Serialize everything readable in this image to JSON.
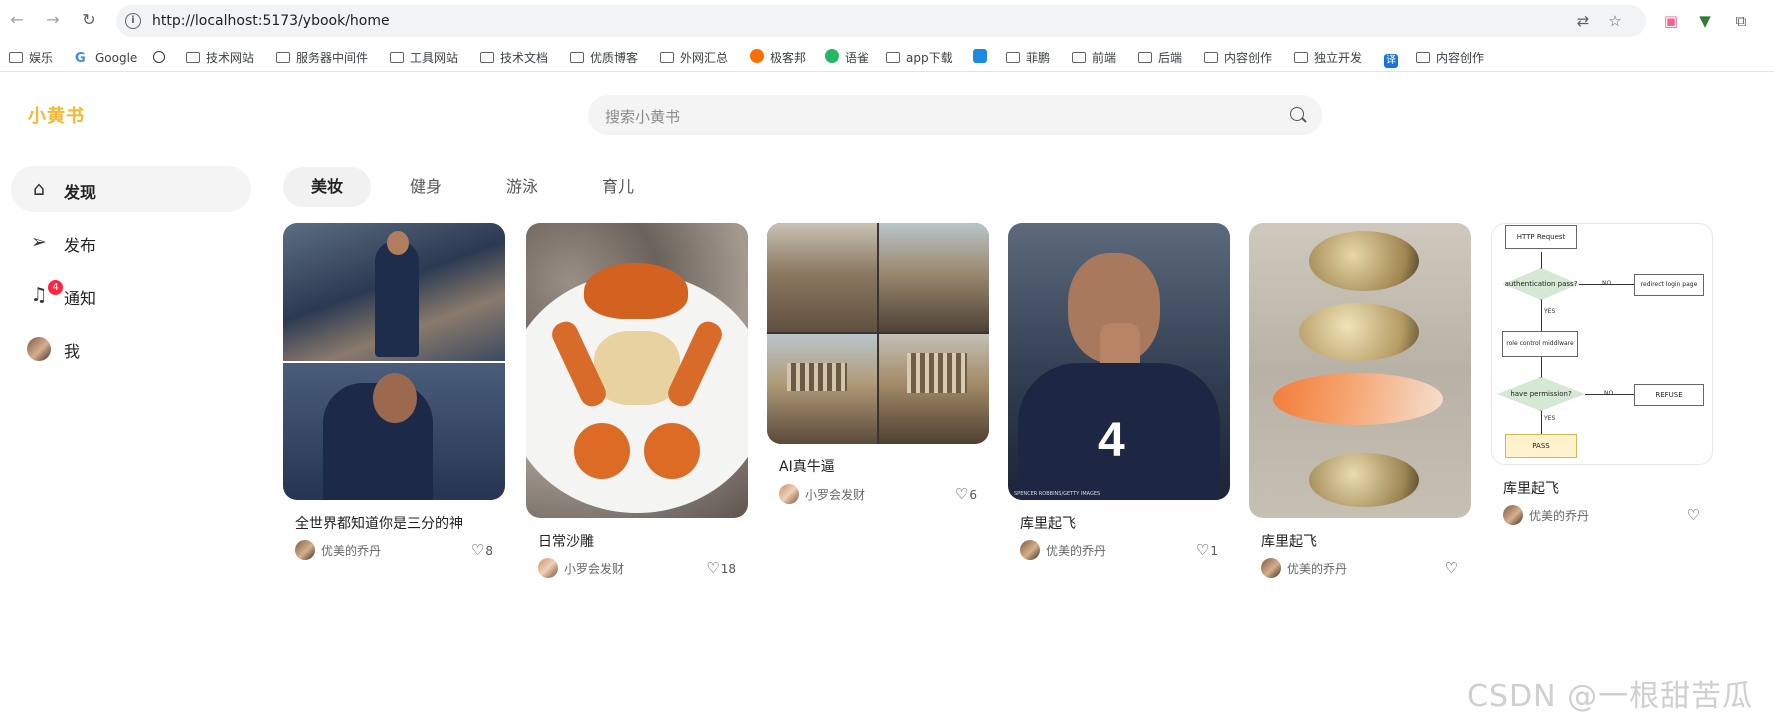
{
  "browser": {
    "url": "http://localhost:5173/ybook/home",
    "bookmarks": [
      "娱乐",
      "Google",
      "",
      "技术网站",
      "服务器中间件",
      "工具网站",
      "技术文档",
      "优质博客",
      "外网汇总",
      "极客邦",
      "语雀",
      "app下载",
      "",
      "菲鹏",
      "前端",
      "后端",
      "内容创作",
      "独立开发",
      "",
      "内容创作"
    ]
  },
  "app": {
    "logo": "小黄书",
    "search_placeholder": "搜索小黄书",
    "sidebar": [
      {
        "label": "发现",
        "icon": "home-icon"
      },
      {
        "label": "发布",
        "icon": "send-icon"
      },
      {
        "label": "通知",
        "icon": "bell-icon",
        "badge": "4"
      },
      {
        "label": "我",
        "icon": "avatar"
      }
    ],
    "tabs": [
      "美妆",
      "健身",
      "游泳",
      "育儿"
    ],
    "active_tab": "美妆",
    "cards": [
      {
        "title": "全世界都知道你是三分的神",
        "author": "优美的乔丹",
        "likes": "8"
      },
      {
        "title": "日常沙雕",
        "author": "小罗会发财",
        "likes": "18"
      },
      {
        "title": "AI真牛逼",
        "author": "小罗会发财",
        "likes": "6"
      },
      {
        "title": "库里起飞",
        "author": "优美的乔丹",
        "likes": "1"
      },
      {
        "title": "库里起飞",
        "author": "优美的乔丹",
        "likes": ""
      },
      {
        "title": "库里起飞",
        "author": "优美的乔丹",
        "likes": ""
      }
    ],
    "flowchart": {
      "request": "HTTP Request",
      "auth": "authentication pass?",
      "no1": "NO",
      "redirect": "redirect login page",
      "yes1": "YES",
      "role": "role control middlware",
      "perm": "have permission?",
      "no2": "NO",
      "refuse": "REFUSE",
      "yes2": "YES",
      "pass": "PASS"
    },
    "photo_credit": "SPENCER ROBBINS/GETTY IMAGES"
  },
  "watermark": "CSDN @一根甜苦瓜",
  "colors": {
    "brand": "#f7b731",
    "badge": "#ff2442"
  }
}
